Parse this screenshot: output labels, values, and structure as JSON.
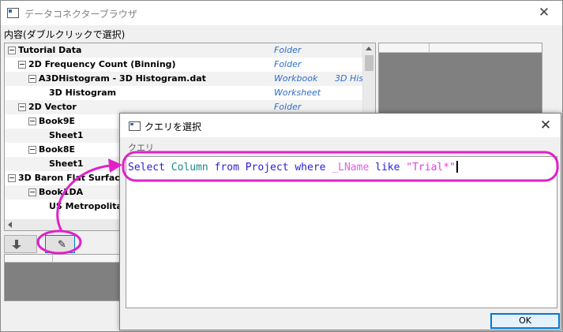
{
  "main_window": {
    "title": "データコネクターブラウザ",
    "section_label": "内容(ダブルクリックで選択)",
    "tree": [
      {
        "label": "Tutorial Data",
        "type": "Folder",
        "extra": ""
      },
      {
        "label": "2D Frequency Count (Binning)",
        "type": "Folder",
        "extra": ""
      },
      {
        "label": "A3DHistogram - 3D Histogram.dat",
        "type": "Workbook",
        "extra": "3D His"
      },
      {
        "label": "3D Histogram",
        "type": "Worksheet",
        "extra": ""
      },
      {
        "label": "2D Vector",
        "type": "Folder",
        "extra": ""
      },
      {
        "label": "Book9E",
        "type": "",
        "extra": ""
      },
      {
        "label": "Sheet1",
        "type": "",
        "extra": ""
      },
      {
        "label": "Book8E",
        "type": "",
        "extra": ""
      },
      {
        "label": "Sheet1",
        "type": "",
        "extra": ""
      },
      {
        "label": "3D Baron Flat Surfac",
        "type": "",
        "extra": ""
      },
      {
        "label": "Book1DA",
        "type": "",
        "extra": ""
      },
      {
        "label": "US Metropolitan",
        "type": "",
        "extra": ""
      }
    ],
    "toolbar": {
      "down_icon": "arrow-down-icon",
      "edit_icon": "pencil-icon",
      "edit_glyph": "✎"
    }
  },
  "query_dialog": {
    "title": "クエリを選択",
    "query_label": "クエリ",
    "query_tokens": [
      {
        "text": "Select ",
        "style": "kw"
      },
      {
        "text": "Column ",
        "style": "col"
      },
      {
        "text": "from ",
        "style": "kw"
      },
      {
        "text": "Project ",
        "style": "kw"
      },
      {
        "text": "where ",
        "style": "kw"
      },
      {
        "text": "_LName ",
        "style": "var"
      },
      {
        "text": "like ",
        "style": "kw"
      },
      {
        "text": "\"Trial*\"",
        "style": "str"
      }
    ],
    "ok_label": "OK"
  },
  "annotation_color": "#e020c8",
  "colors": {
    "type_text": "#2f6ec9",
    "keyword": "#2a1fd6",
    "column": "#1a8a8a",
    "string": "#e33fe3",
    "variable": "#e060e0"
  }
}
